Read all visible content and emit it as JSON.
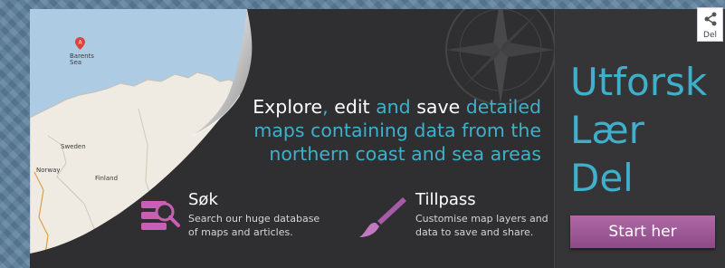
{
  "headline": {
    "explore": "Explore",
    "comma": ",",
    "edit": "edit",
    "and1": "and",
    "save": "save",
    "line1_end": "detailed",
    "line2": "maps containing data from the",
    "line3": "northern coast and sea areas"
  },
  "features": [
    {
      "title": "Søk",
      "desc_line1": "Search our huge database",
      "desc_line2": "of maps and articles.",
      "icon": "search-database-icon"
    },
    {
      "title": "Tillpass",
      "desc_line1": "Customise map layers and",
      "desc_line2": "data to save and share.",
      "icon": "paintbrush-icon"
    }
  ],
  "side": {
    "line1": "Utforsk",
    "line2": "Lær",
    "line3": "Del",
    "button_label": "Start her"
  },
  "share": {
    "label": "Del",
    "icon": "share-icon"
  },
  "map": {
    "pin_label": "A",
    "labels": [
      "Barents Sea",
      "Sweden",
      "Norway",
      "Finland"
    ]
  },
  "colors": {
    "accent_blue": "#3fb0cc",
    "accent_purple": "#9c5a96",
    "panel_dark": "#2f2f31",
    "background": "#5d7f9c"
  }
}
